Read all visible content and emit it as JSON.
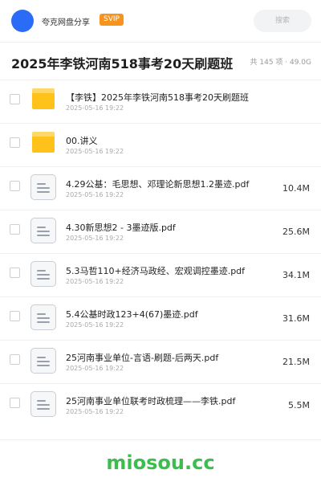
{
  "header": {
    "site_name": "夸克网盘分享",
    "badge": "SVIP",
    "search_placeholder": "搜索",
    "colors": {
      "avatar": "#2b6cf6",
      "badge": "#f7941d"
    }
  },
  "share": {
    "title": "2025年李铁河南518事考20天刷题班",
    "meta": "共 145 项 · 49.0G"
  },
  "items": [
    {
      "type": "folder",
      "name": "【李铁】2025年李铁河南518事考20天刷题班",
      "date": "2025-05-16 19:22",
      "size": ""
    },
    {
      "type": "folder",
      "name": "00.讲义",
      "date": "2025-05-16 19:22",
      "size": ""
    },
    {
      "type": "file",
      "name": "4.29公基：毛思想、邓理论新思想1.2墨迹.pdf",
      "date": "2025-05-16 19:22",
      "size": "10.4M"
    },
    {
      "type": "file",
      "name": "4.30新思想2 - 3墨迹版.pdf",
      "date": "2025-05-16 19:22",
      "size": "25.6M"
    },
    {
      "type": "file",
      "name": "5.3马哲110+经济马政经、宏观调控墨迹.pdf",
      "date": "2025-05-16 19:22",
      "size": "34.1M"
    },
    {
      "type": "file",
      "name": "5.4公基时政123+4(67)墨迹.pdf",
      "date": "2025-05-16 19:22",
      "size": "31.6M"
    },
    {
      "type": "file",
      "name": "25河南事业单位-言语-刷题-后两天.pdf",
      "date": "2025-05-16 19:22",
      "size": "21.5M"
    },
    {
      "type": "file",
      "name": "25河南事业单位联考时政梳理——李铁.pdf",
      "date": "2025-05-16 19:22",
      "size": "5.5M"
    }
  ],
  "watermark": "miosou.cc"
}
